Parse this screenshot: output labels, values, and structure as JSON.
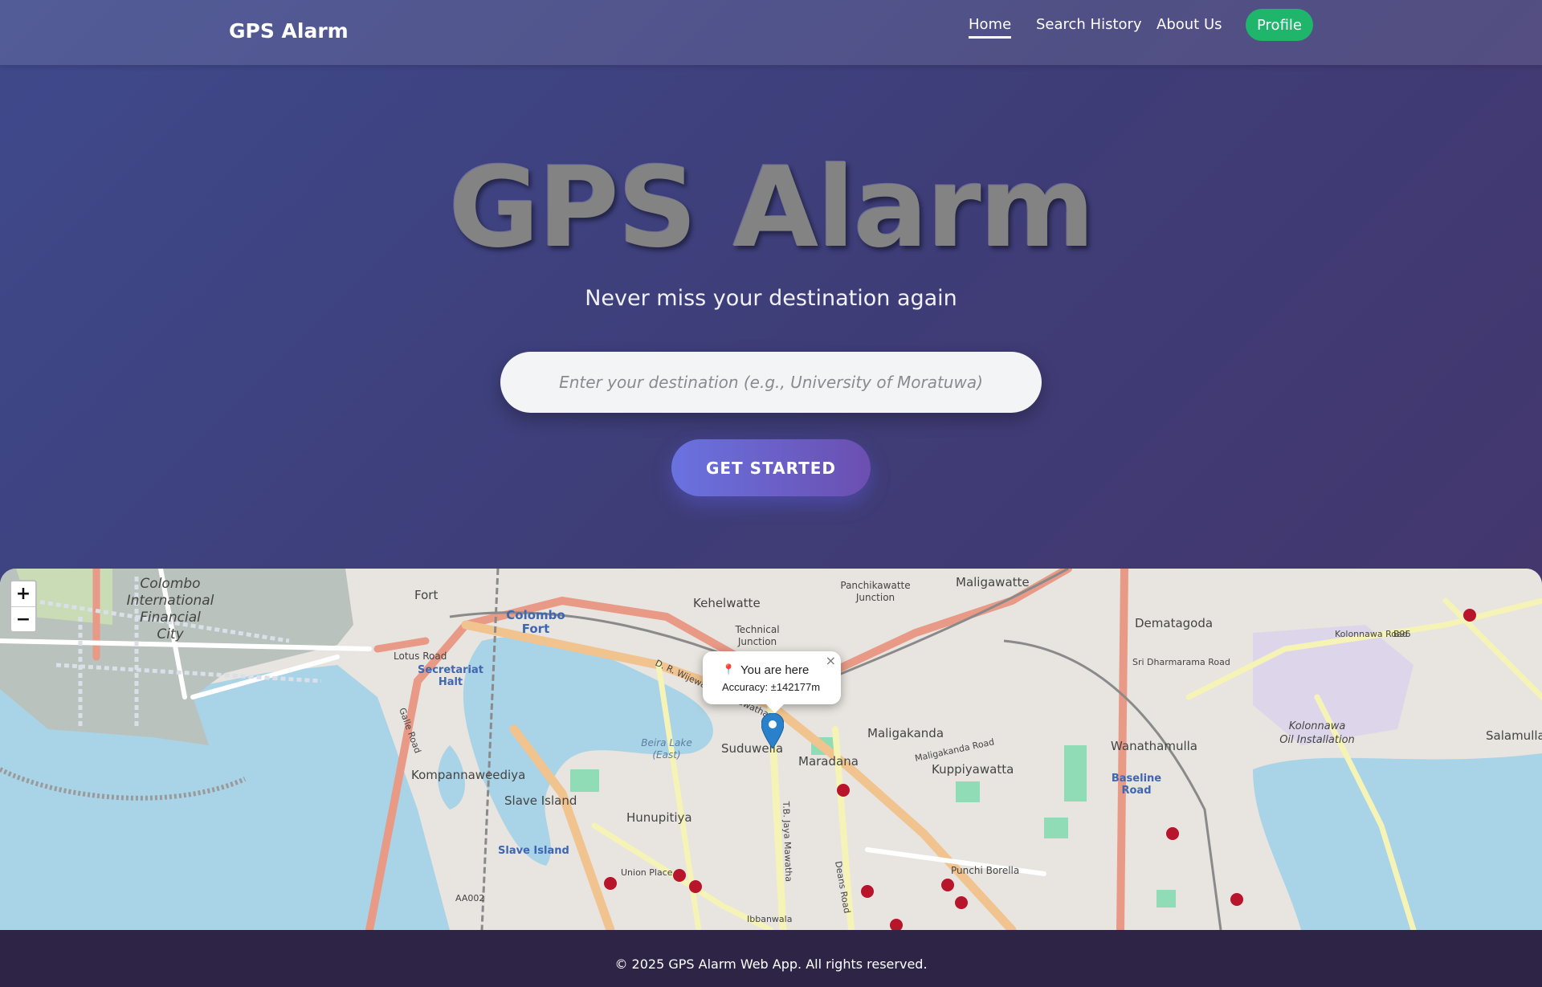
{
  "navbar": {
    "brand": "GPS Alarm",
    "links": [
      {
        "label": "Home",
        "active": true
      },
      {
        "label": "Search History",
        "active": false
      },
      {
        "label": "About Us",
        "active": false
      }
    ],
    "profile_label": "Profile",
    "profile_color": "#1fb66c"
  },
  "hero": {
    "title": "GPS Alarm",
    "subtitle": "Never miss your destination again",
    "destination_placeholder": "Enter your destination (e.g., University of Moratuwa)",
    "destination_value": "",
    "cta_label": "GET STARTED"
  },
  "map": {
    "zoom_in_label": "+",
    "zoom_out_label": "−",
    "popup": {
      "title": "You are here",
      "accuracy": "Accuracy: ±142177m",
      "close_label": "×",
      "pin_icon": "round-pushpin-icon"
    },
    "labels": {
      "colombo_city": "Colombo",
      "international": "International",
      "financial": "Financial",
      "city": "City",
      "fort": "Fort",
      "colombo_fort": "Colombo",
      "colombo_fort2": "Fort",
      "kehelwatte": "Kehelwatte",
      "panchikawatte": "Panchikawatte",
      "junction": "Junction",
      "technical": "Technical",
      "junction2": "Junction",
      "maligawatte": "Maligawatte",
      "dematagoda": "Dematagoda",
      "secretariat": "Secretariat",
      "halt": "Halt",
      "lotus_road": "Lotus Road",
      "suduwella": "Suduwella",
      "maradana": "Maradana",
      "maligakanda": "Maligakanda",
      "kuppiyawatta": "Kuppiyawatta",
      "wanathamulla": "Wanathamulla",
      "baseline_road": "Baseline",
      "baseline_road2": "Road",
      "kolonnawa": "Kolonnawa",
      "oil_installation": "Oil Installation",
      "salamulla": "Salamulla",
      "kompannaweediya": "Kompannaweediya",
      "slave_island": "Slave Island",
      "slave_island_station": "Slave Island",
      "hunupitiya": "Hunupitiya",
      "punchi_borella": "Punchi Borella",
      "beira_lake": "Beira Lake",
      "beira_lake_east": "(East)",
      "union_place": "Union Place",
      "ibbanwala": "Ibbanwala",
      "kolonnawa_road": "Kolonnawa Road",
      "sri_dharmarama_road": "Sri Dharmarama Road",
      "b96": "B96",
      "aa002": "AA002",
      "dr_wijewardene": "D. R. Wijewardene Mawatha",
      "tb_jaya": "T.B. Jaya Mawatha",
      "maligakanda_road": "Maligakanda Road",
      "deans_road": "Deans Road",
      "galle_road": "Galle Road"
    }
  },
  "footer": {
    "text": "© 2025 GPS Alarm Web App. All rights reserved."
  }
}
